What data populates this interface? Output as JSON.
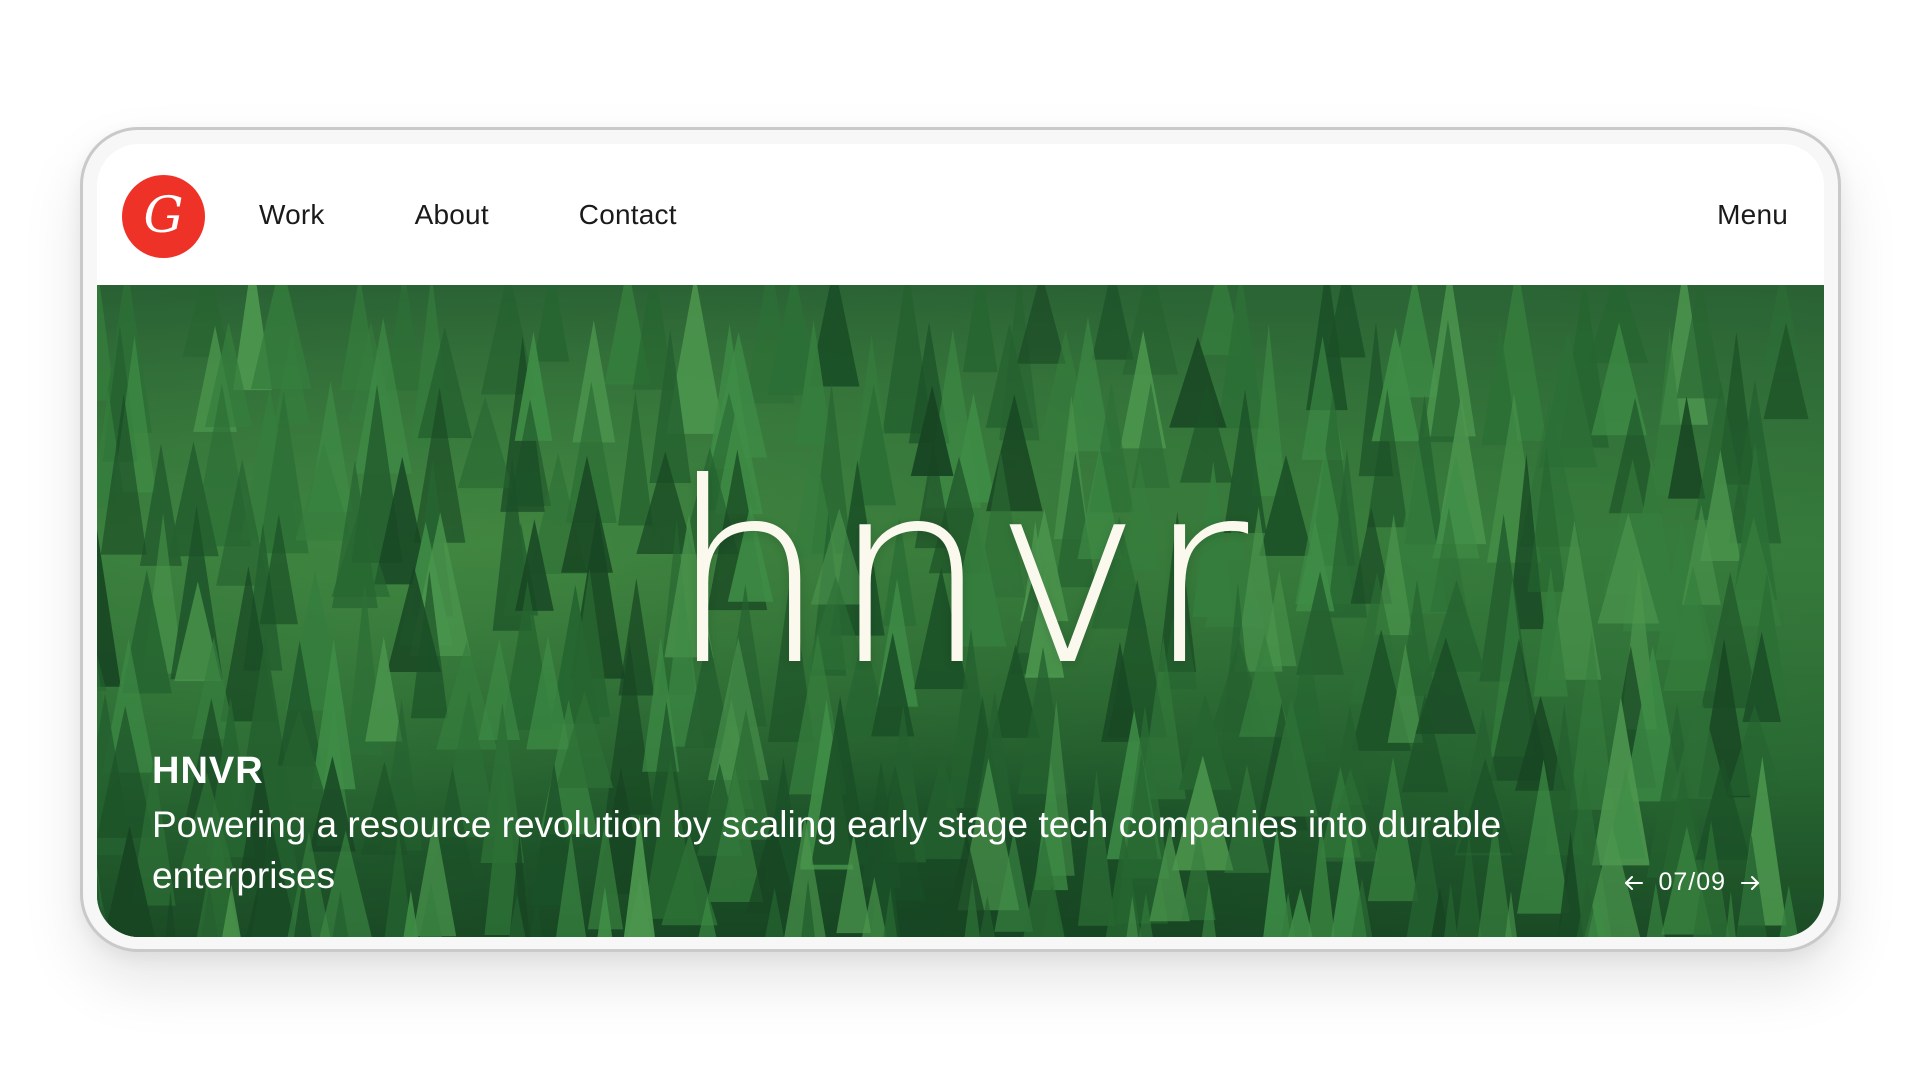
{
  "header": {
    "logo_letter": "G",
    "nav": [
      {
        "label": "Work"
      },
      {
        "label": "About"
      },
      {
        "label": "Contact"
      }
    ],
    "menu_label": "Menu"
  },
  "hero": {
    "brand_mark": "hnvr",
    "title": "HNVR",
    "description": "Powering a resource revolution by scaling early stage tech companies into durable enterprises",
    "pager": {
      "current": "07/09",
      "prev_icon": "arrow-left-icon",
      "next_icon": "arrow-right-icon"
    }
  },
  "colors": {
    "logo_bg": "#ee3227",
    "forest": "#2e7438",
    "brand_text": "#fbf8ee"
  }
}
